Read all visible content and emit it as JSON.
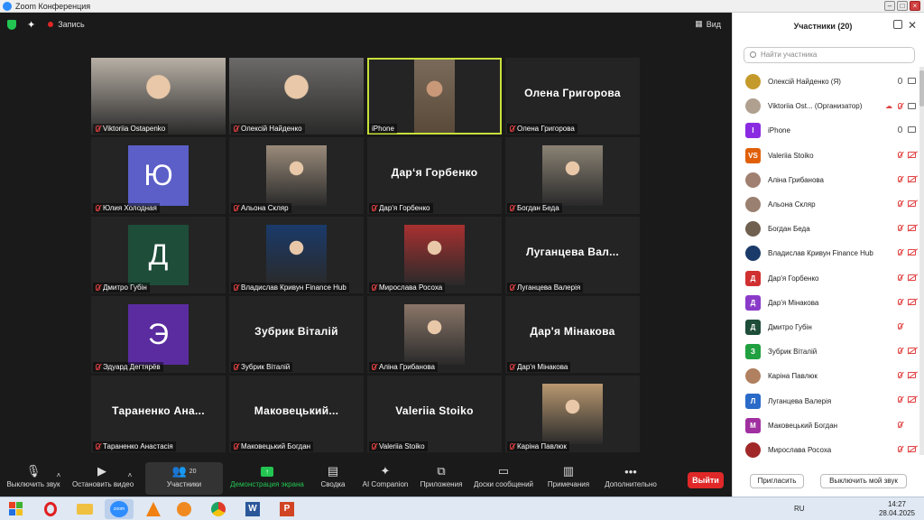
{
  "window": {
    "title": "Zoom Конференция"
  },
  "top": {
    "record_label": "Запись",
    "view_label": "Вид"
  },
  "tiles": [
    {
      "name": "Viktoriia Ostapenko",
      "kind": "photo",
      "bg": "#b8b0a6"
    },
    {
      "name": "Олексій Найденко",
      "kind": "photo",
      "bg": "#6c6a68"
    },
    {
      "name": "iPhone",
      "kind": "video",
      "bg": "#5a4a3a",
      "active": true
    },
    {
      "name": "Олена Григорова",
      "kind": "text",
      "big": "Олена Григорова"
    },
    {
      "name": "Юлия Холодная",
      "kind": "letter",
      "letter": "Ю",
      "color": "#5b5fc7"
    },
    {
      "name": "Альона Скляр",
      "kind": "photo",
      "bg": "#9a8b7a"
    },
    {
      "name": "Дар'я Горбенко",
      "kind": "text",
      "big": "Дар‘я Горбенко"
    },
    {
      "name": "Богдан Беда",
      "kind": "photo",
      "bg": "#8a8274"
    },
    {
      "name": "Дмитро Губін",
      "kind": "letter",
      "letter": "Д",
      "color": "#1e4d3a"
    },
    {
      "name": "Владислав Кривун Finance Hub",
      "kind": "photo",
      "bg": "#1a3a6a"
    },
    {
      "name": "Мирослава Росоха",
      "kind": "photo",
      "bg": "#a83030"
    },
    {
      "name": "Луганцева Валерія",
      "kind": "text",
      "big": "Луганцева  Вал..."
    },
    {
      "name": "Эдуард Дегтярёв",
      "kind": "letter",
      "letter": "Э",
      "color": "#5a2ca0"
    },
    {
      "name": "Зубрик Віталій",
      "kind": "text",
      "big": "Зубрик Віталій"
    },
    {
      "name": "Аліна Грибанова",
      "kind": "photo",
      "bg": "#8a7668"
    },
    {
      "name": "Дар'я Мінакова",
      "kind": "text",
      "big": "Дар'я Мінакова"
    },
    {
      "name": "Тараненко Анастасія",
      "kind": "text",
      "big": "Тараненко  Ана..."
    },
    {
      "name": "Маковецький Богдан",
      "kind": "text",
      "big": "Маковецький..."
    },
    {
      "name": "Valeriia Stoiko",
      "kind": "text",
      "big": "Valeriia Stoiko"
    },
    {
      "name": "Каріна Павлюк",
      "kind": "photo",
      "bg": "#b89870"
    }
  ],
  "toolbar": {
    "mute": "Выключить звук",
    "video": "Остановить видео",
    "participants": "Участники",
    "participants_count": "20",
    "share": "Демонстрация экрана",
    "summary": "Сводка",
    "ai": "AI Companion",
    "apps": "Приложения",
    "whiteboards": "Доски сообщений",
    "notes": "Примечания",
    "more": "Дополнительно",
    "leave": "Выйти"
  },
  "panel": {
    "title": "Участники (20)",
    "search_placeholder": "Найти участника",
    "invite": "Пригласить",
    "mute_me": "Выключить мой звук",
    "participants": [
      {
        "name": "Олексій Найденко (Я)",
        "initials": "",
        "color": "#c49a2a",
        "mic": "on",
        "video": "on"
      },
      {
        "name": "Viktoriia Ost... (Организатор)",
        "initials": "",
        "color": "#b0a090",
        "mic": "off",
        "video": "on",
        "host": true
      },
      {
        "name": "iPhone",
        "initials": "I",
        "color": "#8a2be2",
        "mic": "on",
        "video": "on"
      },
      {
        "name": "Valeriia Stoiko",
        "initials": "VS",
        "color": "#e0600a",
        "mic": "off",
        "video": "off"
      },
      {
        "name": "Аліна Грибанова",
        "initials": "",
        "color": "#a08070",
        "mic": "off",
        "video": "off"
      },
      {
        "name": "Альона Скляр",
        "initials": "",
        "color": "#9a8070",
        "mic": "off",
        "video": "off"
      },
      {
        "name": "Богдан Беда",
        "initials": "",
        "color": "#706050",
        "mic": "off",
        "video": "off"
      },
      {
        "name": "Владислав Кривун Finance Hub",
        "initials": "",
        "color": "#1a3a6a",
        "mic": "off",
        "video": "off"
      },
      {
        "name": "Дар'я Горбенко",
        "initials": "Д",
        "color": "#d03030",
        "mic": "off",
        "video": "off"
      },
      {
        "name": "Дар'я Мінакова",
        "initials": "Д",
        "color": "#8a3ac8",
        "mic": "off",
        "video": "off"
      },
      {
        "name": "Дмитро Губін",
        "initials": "Д",
        "color": "#1e4d3a",
        "mic": "off",
        "video": "none"
      },
      {
        "name": "Зубрик Віталій",
        "initials": "З",
        "color": "#20a040",
        "mic": "off",
        "video": "off"
      },
      {
        "name": "Каріна Павлюк",
        "initials": "",
        "color": "#b08060",
        "mic": "off",
        "video": "off"
      },
      {
        "name": "Луганцева Валерія",
        "initials": "Л",
        "color": "#2a6ac8",
        "mic": "off",
        "video": "off"
      },
      {
        "name": "Маковецький Богдан",
        "initials": "М",
        "color": "#a030a0",
        "mic": "off",
        "video": "none"
      },
      {
        "name": "Мирослава Росоха",
        "initials": "",
        "color": "#a02828",
        "mic": "off",
        "video": "off"
      }
    ]
  },
  "taskbar": {
    "lang": "RU",
    "time": "14:27",
    "date": "28.04.2025",
    "zoom_label": "zoom"
  }
}
